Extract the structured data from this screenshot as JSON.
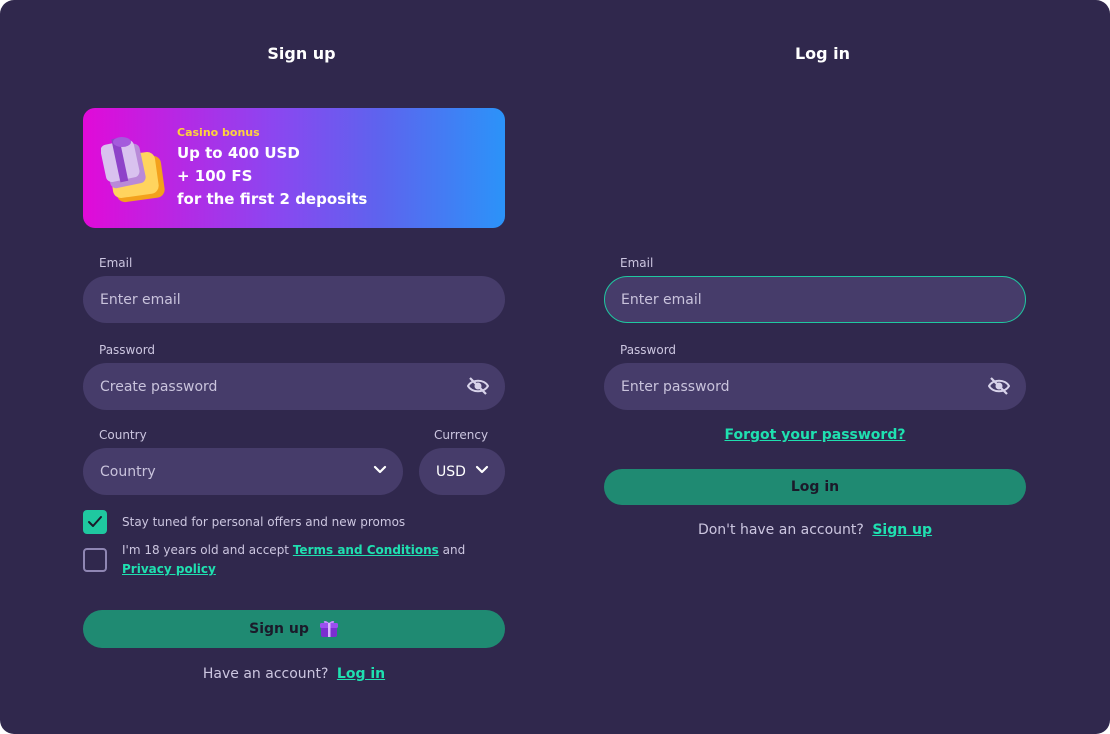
{
  "signup": {
    "title": "Sign up",
    "banner": {
      "tag": "Casino bonus",
      "line1": "Up to 400 USD",
      "line2": "+ 100 FS",
      "line3": "for the first 2 deposits"
    },
    "email_label": "Email",
    "email_placeholder": "Enter email",
    "password_label": "Password",
    "password_placeholder": "Create password",
    "country_label": "Country",
    "country_value": "Country",
    "currency_label": "Currency",
    "currency_value": "USD",
    "promos_text": "Stay tuned for personal offers and new promos",
    "promos_checked": true,
    "age_text_prefix": "I'm 18 years old and accept ",
    "terms_link": "Terms and Conditions",
    "age_text_and": " and ",
    "privacy_link": "Privacy policy",
    "age_checked": false,
    "button_label": "Sign up",
    "footer_text": "Have an account?",
    "footer_link": "Log in"
  },
  "login": {
    "title": "Log in",
    "email_label": "Email",
    "email_placeholder": "Enter email",
    "password_label": "Password",
    "password_placeholder": "Enter password",
    "forgot_link": "Forgot your password?",
    "button_label": "Log in",
    "footer_text": "Don't have an account?",
    "footer_link": "Sign up"
  },
  "colors": {
    "background": "#30284d",
    "field": "#463c6a",
    "accent": "#1fe0b0",
    "button": "#1f8a72",
    "banner_start": "#e10ad8",
    "banner_end": "#2b93f9"
  },
  "icons": [
    "gift-icon",
    "eye-off-icon",
    "chevron-down-icon",
    "checkmark-icon"
  ]
}
